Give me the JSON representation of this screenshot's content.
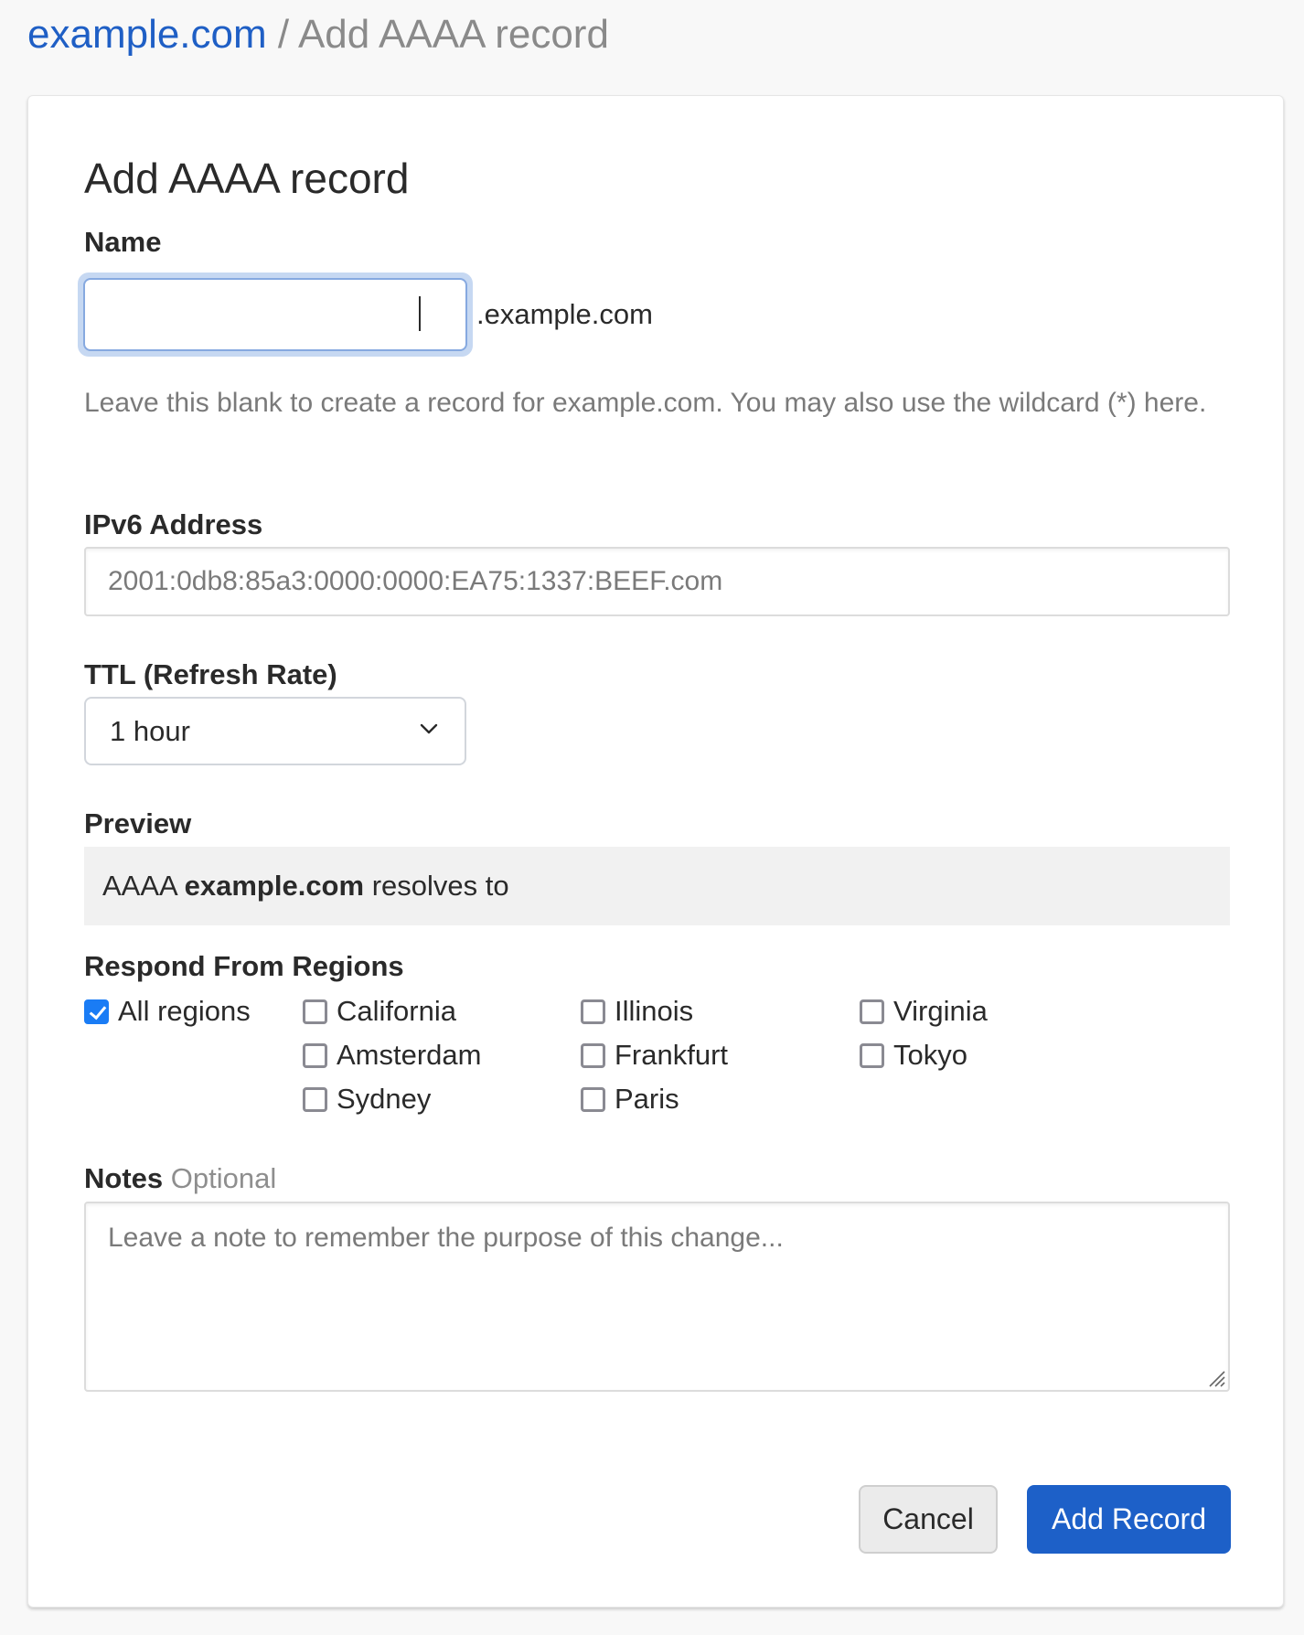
{
  "breadcrumb": {
    "domain_link": "example.com",
    "separator": "/",
    "current": "Add AAAA record"
  },
  "form": {
    "title": "Add AAAA record",
    "name": {
      "label": "Name",
      "value": "",
      "suffix": ".example.com",
      "help": "Leave this blank to create a record for example.com. You may also use the wildcard (*) here."
    },
    "ipv6": {
      "label": "IPv6 Address",
      "placeholder": "2001:0db8:85a3:0000:0000:EA75:1337:BEEF.com",
      "value": ""
    },
    "ttl": {
      "label": "TTL (Refresh Rate)",
      "selected": "1 hour",
      "icon": "chevron-down-icon"
    },
    "preview": {
      "label": "Preview",
      "type": "AAAA",
      "host": "example.com",
      "suffix_text": "resolves to"
    },
    "regions": {
      "label": "Respond From Regions",
      "items": [
        {
          "label": "All regions",
          "checked": true
        },
        {
          "label": "California",
          "checked": false
        },
        {
          "label": "Illinois",
          "checked": false
        },
        {
          "label": "Virginia",
          "checked": false
        },
        {
          "label": "Amsterdam",
          "checked": false
        },
        {
          "label": "Frankfurt",
          "checked": false
        },
        {
          "label": "Tokyo",
          "checked": false
        },
        {
          "label": "Sydney",
          "checked": false
        },
        {
          "label": "Paris",
          "checked": false
        }
      ]
    },
    "notes": {
      "label": "Notes",
      "optional_label": "Optional",
      "placeholder": "Leave a note to remember the purpose of this change...",
      "value": ""
    },
    "actions": {
      "cancel_label": "Cancel",
      "submit_label": "Add Record"
    }
  },
  "colors": {
    "link": "#1f5fc5",
    "primary_button": "#1d60c8",
    "checkbox_checked": "#1a7cf5",
    "focus_ring": "#c6d8f2",
    "preview_bg": "#f1f1f1"
  }
}
